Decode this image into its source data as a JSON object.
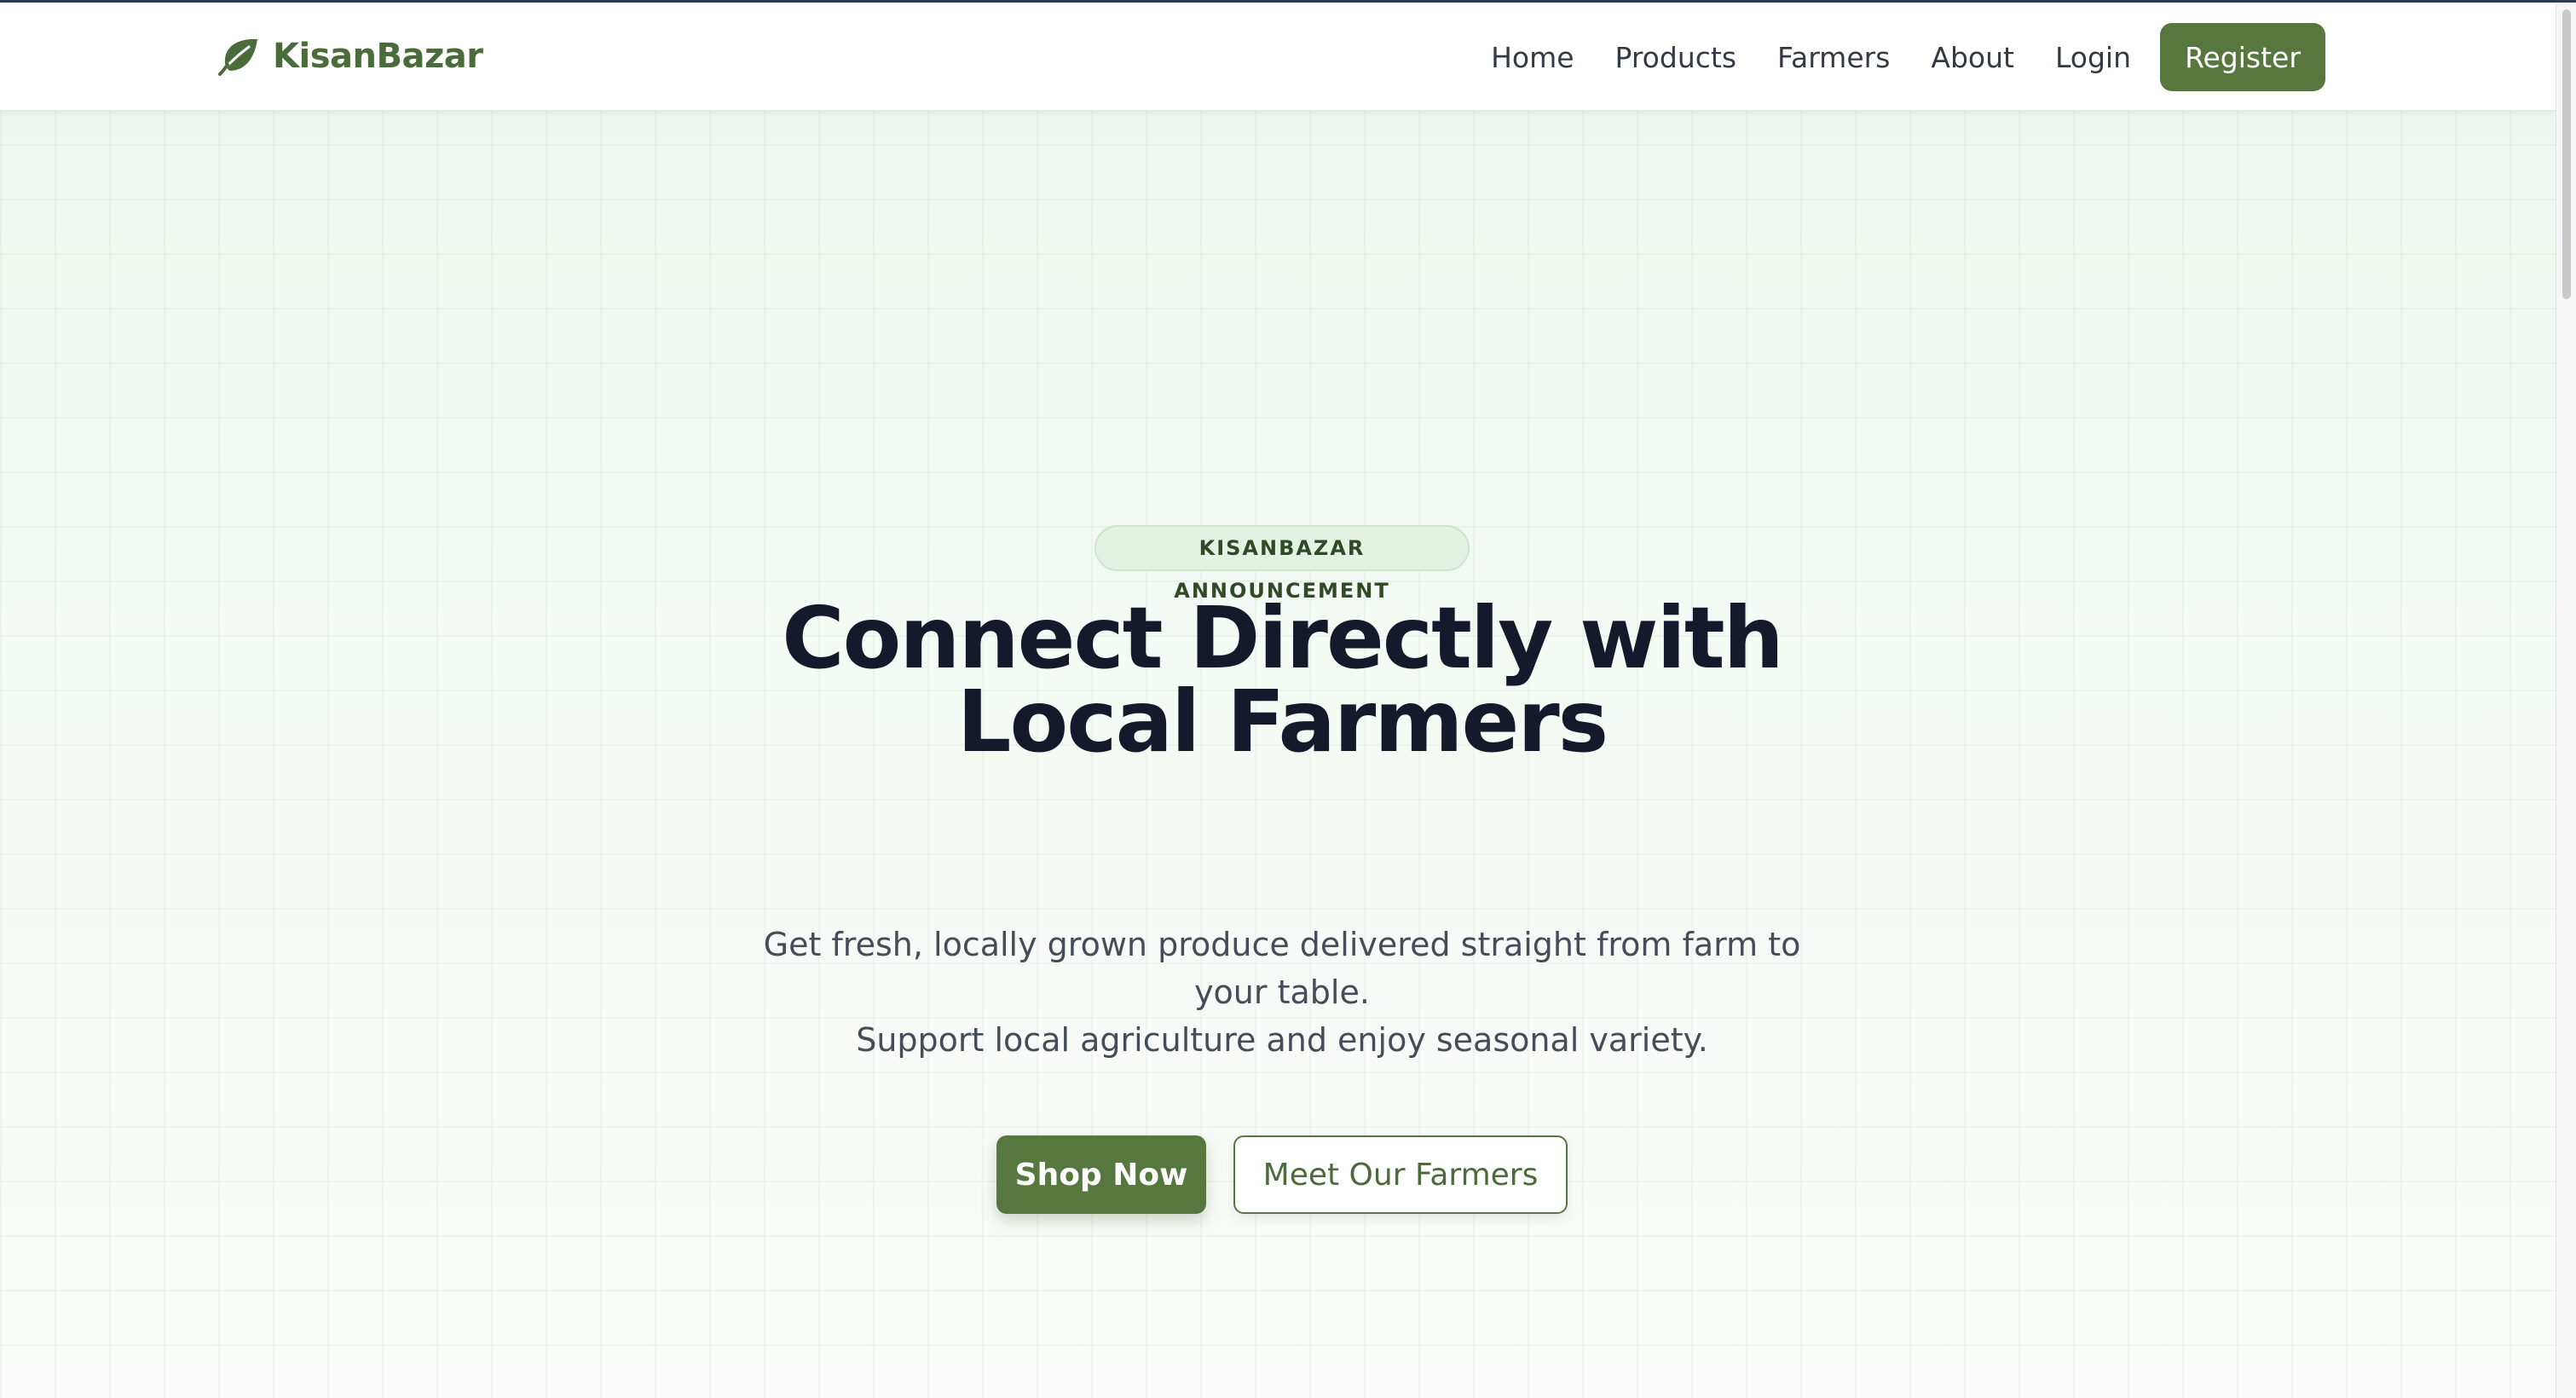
{
  "brand": {
    "name": "KisanBazar",
    "icon": "leaf-icon",
    "color": "#4a6b3a"
  },
  "nav": {
    "items": [
      {
        "label": "Home"
      },
      {
        "label": "Products"
      },
      {
        "label": "Farmers"
      },
      {
        "label": "About"
      },
      {
        "label": "Login"
      }
    ],
    "register_label": "Register"
  },
  "hero": {
    "badge": "KISANBAZAR ANNOUNCEMENT",
    "headline_line1": "Connect Directly with",
    "headline_line2": "Local Farmers",
    "subtext_line1": "Get fresh, locally grown produce delivered straight from farm to your table.",
    "subtext_line2": "Support local agriculture and enjoy seasonal variety.",
    "primary_cta": "Shop Now",
    "secondary_cta": "Meet Our Farmers"
  },
  "colors": {
    "accent": "#56783f",
    "heading": "#141a2c",
    "body_text": "#454d59",
    "hero_bg": "#eef7ef"
  }
}
